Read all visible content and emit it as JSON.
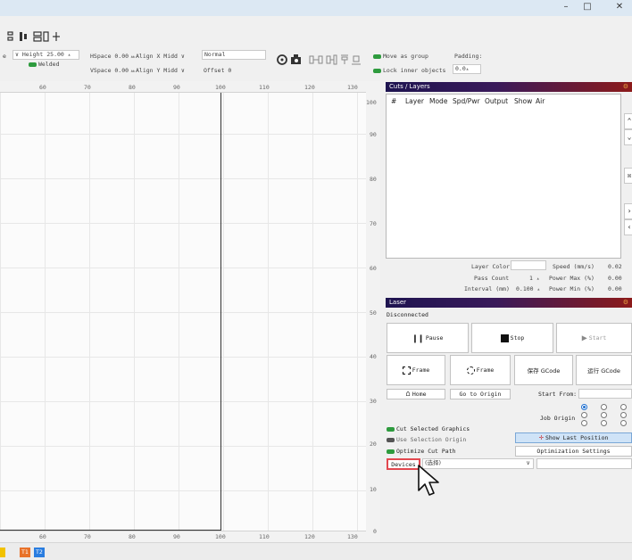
{
  "window": {
    "minimize_glyph": "–",
    "maximize_glyph": "□",
    "close_glyph": "✕"
  },
  "toolbar": {
    "icons": [
      "distribute-icon",
      "align-icon",
      "group-icon",
      "grid-array-icon"
    ],
    "height_label": "Height 25.00",
    "welded_label": "Welded",
    "hspace_label": "HSpace 0.00",
    "vspace_label": "VSpace 0.00",
    "align_x_label": "Align X Midd",
    "align_y_label": "Align Y Midd",
    "normal_label": "Normal",
    "offset_label": "Offset 0",
    "left_partial": "e",
    "move_as_group": "Move as group",
    "lock_inner_objects": "Lock inner objects",
    "padding_label": "Padding:",
    "padding_value": "0.0"
  },
  "ruler": {
    "top_labels": [
      "60",
      "70",
      "80",
      "90",
      "100",
      "110",
      "120",
      "130"
    ],
    "bottom_labels": [
      "60",
      "70",
      "80",
      "90",
      "100",
      "110",
      "120",
      "130"
    ],
    "vertical_labels": [
      "100",
      "90",
      "80",
      "70",
      "60",
      "50",
      "40",
      "30",
      "20",
      "10",
      "0"
    ]
  },
  "cuts_layers": {
    "title": "Cuts / Layers",
    "columns": [
      "#",
      "Layer",
      "Mode",
      "Spd/Pwr",
      "Output",
      "Show",
      "Air"
    ],
    "layer_color_label": "Layer Color",
    "pass_count_label": "Pass Count",
    "pass_count_value": "1",
    "interval_label": "Interval (mm)",
    "interval_value": "0.100",
    "speed_label": "Speed (mm/s)",
    "speed_value": "0.02",
    "power_max_label": "Power Max (%)",
    "power_max_value": "0.00",
    "power_min_label": "Power Min (%)",
    "power_min_value": "0.00"
  },
  "laser": {
    "title": "Laser",
    "status": "Disconnected",
    "pause": "Pause",
    "stop": "Stop",
    "start": "Start",
    "frame1": "Frame",
    "frame2": "Frame",
    "save_gcode": "保存 GCode",
    "run_gcode": "运行 GCode",
    "home": "Home",
    "go_to_origin": "Go to Origin",
    "start_from": "Start From:",
    "job_origin": "Job Origin",
    "cut_selected": "Cut Selected Graphics",
    "use_selection_origin": "Use Selection Origin",
    "optimize_cut_path": "Optimize Cut Path",
    "show_last_position": "Show Last Position",
    "optimization_settings": "Optimization Settings",
    "devices": "Devices",
    "device_select": "(选择)"
  },
  "statusbar": {
    "badges": [
      "T1",
      "T2"
    ],
    "colors": {
      "orange": "#e8722a",
      "blue": "#2a7de0",
      "yellow": "#f2c200"
    }
  },
  "colors": {
    "accent_green": "#2e9b3e",
    "highlight_red": "#e2474f",
    "panel_gradient_start": "#1e1450",
    "panel_gradient_end": "#8c1a1a"
  }
}
